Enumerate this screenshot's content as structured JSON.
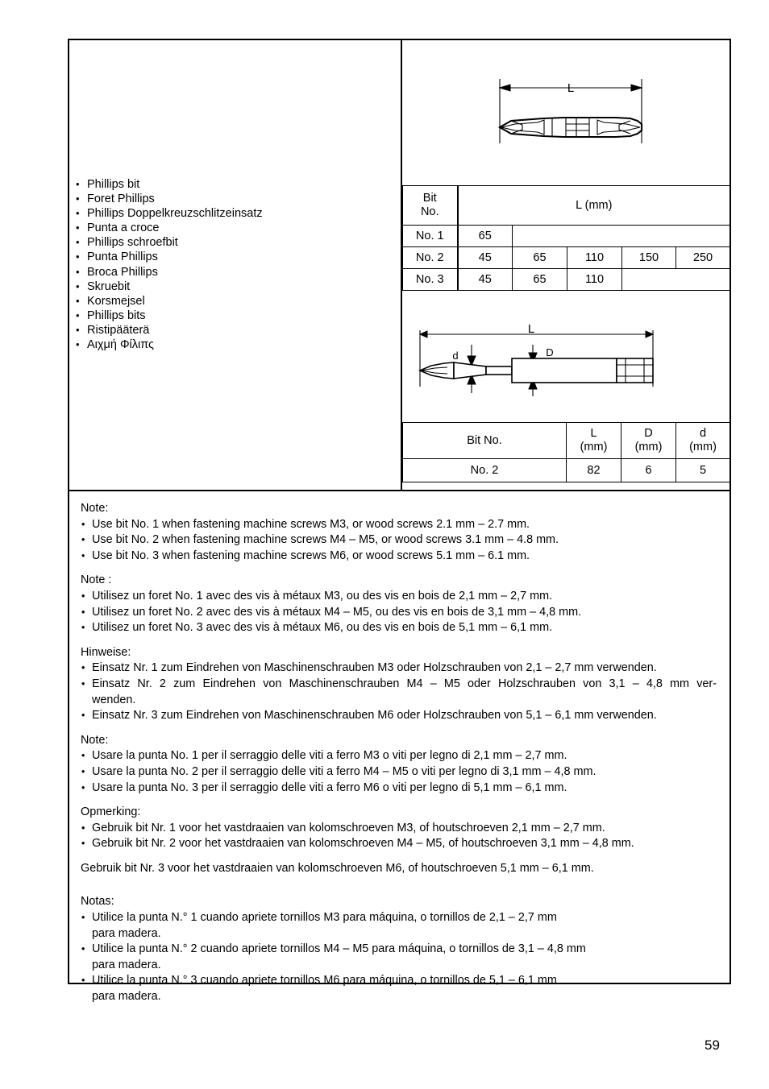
{
  "page_number": "59",
  "product_names": [
    "Phillips bit",
    "Foret Phillips",
    "Phillips Doppelkreuzschlitzeinsatz",
    "Punta a croce",
    "Phillips schroefbit",
    "Punta Phillips",
    "Broca Phillips",
    "Skruebit",
    "Korsmejsel",
    "Phillips bits",
    "Ristipääterä",
    "Αιχμή Φίλιπς"
  ],
  "figure_top": {
    "dimension_label": "L",
    "description": "double-ended-phillips-bit"
  },
  "figure_bottom": {
    "dimension_labels": [
      "L",
      "d",
      "D"
    ],
    "description": "single-ended-phillips-bit-with-shank"
  },
  "table_top": {
    "header_bit_no": "Bit\nNo.",
    "header_bit_no_line1": "Bit",
    "header_bit_no_line2": "No.",
    "header_length": "L (mm)",
    "rows": [
      {
        "bit_no": "No. 1",
        "values": [
          "65"
        ]
      },
      {
        "bit_no": "No. 2",
        "values": [
          "45",
          "65",
          "110",
          "150",
          "250"
        ]
      },
      {
        "bit_no": "No. 3",
        "values": [
          "45",
          "65",
          "110"
        ]
      }
    ]
  },
  "table_bottom": {
    "headers": {
      "bit_no": "Bit No.",
      "l_line1": "L",
      "l_line2": "(mm)",
      "d_upper_line1": "D",
      "d_upper_line2": "(mm)",
      "d_lower_line1": "d",
      "d_lower_line2": "(mm)"
    },
    "rows": [
      {
        "bit_no": "No. 2",
        "L": "82",
        "D": "6",
        "d": "5"
      }
    ]
  },
  "notes": {
    "english": {
      "heading": "Note:",
      "lines": [
        "Use bit No. 1 when fastening machine screws M3, or wood screws 2.1 mm – 2.7 mm.",
        "Use bit No. 2 when fastening machine screws M4 – M5, or wood screws 3.1 mm – 4.8 mm.",
        "Use bit No. 3 when fastening machine screws M6, or wood screws 5.1 mm – 6.1 mm."
      ]
    },
    "french": {
      "heading": "Note :",
      "lines": [
        "Utilisez un foret No. 1 avec des vis à métaux M3, ou des vis en bois de 2,1 mm – 2,7 mm.",
        "Utilisez un foret No. 2 avec des vis à métaux M4 – M5, ou des vis en bois de 3,1 mm –  4,8 mm.",
        "Utilisez un foret No. 3 avec des vis à métaux M6, ou des vis en bois de 5,1 mm – 6,1 mm."
      ]
    },
    "german": {
      "heading": "Hinweise:",
      "line1": "Einsatz Nr. 1 zum Eindrehen von Maschinenschrauben M3 oder Holzschrauben von 2,1 –  2,7 mm verwenden.",
      "line2a": "Einsatz Nr. 2 zum Eindrehen von Maschinenschrauben M4 – M5 oder Holzschrauben von 3,1 – 4,8 mm ver-",
      "line2b": "wenden.",
      "line3": "Einsatz Nr. 3 zum Eindrehen von Maschinenschrauben M6 oder Holzschrauben von 5,1 –  6,1 mm verwenden."
    },
    "italian": {
      "heading": "Note:",
      "lines": [
        "Usare la punta No. 1 per il serraggio delle viti a ferro M3 o viti per legno di 2,1 mm – 2,7 mm.",
        "Usare la punta No. 2 per il serraggio delle viti a ferro M4 – M5 o viti per legno di 3,1 mm – 4,8 mm.",
        "Usare la punta No. 3 per il serraggio delle viti a ferro M6 o viti per legno di 5,1 mm – 6,1 mm."
      ]
    },
    "dutch": {
      "heading": "Opmerking:",
      "lines": [
        "Gebruik bit Nr. 1 voor het vastdraaien van kolomschroeven M3, of houtschroeven 2,1 mm – 2,7 mm.",
        "Gebruik bit Nr. 2 voor het vastdraaien van kolomschroeven M4 – M5, of houtschroeven 3,1 mm – 4,8 mm."
      ],
      "plain_line": "Gebruik bit Nr. 3 voor het vastdraaien van kolomschroeven M6, of houtschroeven 5,1 mm – 6,1 mm."
    },
    "spanish": {
      "heading": "Notas:",
      "items": [
        {
          "first": "Utilice la punta N.° 1 cuando apriete tornillos M3 para máquina, o tornillos de 2,1 – 2,7 mm",
          "second": "para madera."
        },
        {
          "first": "Utilice la punta N.° 2 cuando apriete tornillos M4 – M5 para máquina, o tornillos de 3,1 – 4,8 mm",
          "second": "para madera."
        },
        {
          "first": "Utilice la punta N.° 3 cuando apriete tornillos M6 para máquina, o tornillos de 5,1 – 6,1 mm",
          "second": "para madera."
        }
      ]
    }
  }
}
